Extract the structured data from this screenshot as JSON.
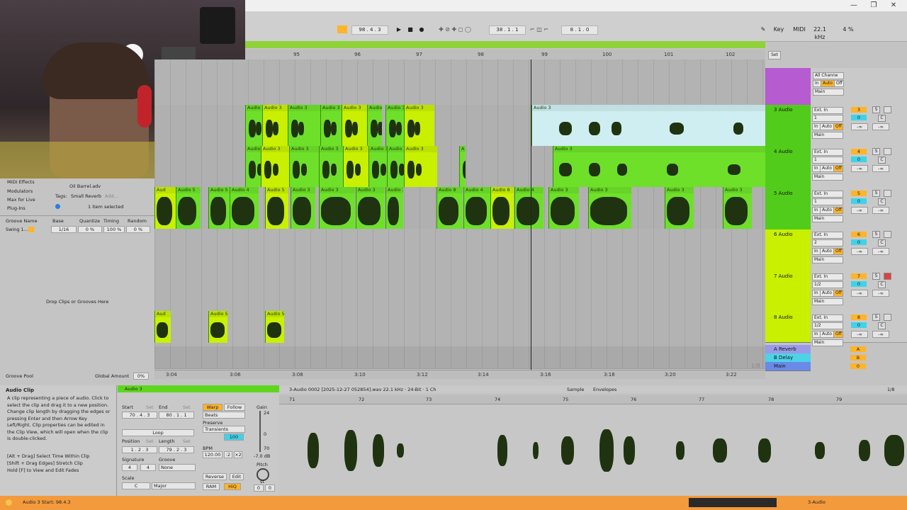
{
  "window": {
    "minimize": "—",
    "restore": "❐",
    "close": "✕"
  },
  "transport": {
    "position": "98 .  4 .  3",
    "loop_start": "38 .  1 .  1",
    "loop_length": "8 .  1 .  0",
    "key_label": "Key",
    "midi_label": "MIDI",
    "sample_rate": "22.1 kHz",
    "cpu": "4 %"
  },
  "ruler": {
    "bars": [
      "95",
      "96",
      "97",
      "98",
      "99",
      "100",
      "101",
      "102"
    ],
    "set_label": "Set"
  },
  "tracks": [
    {
      "name": "3 Audio",
      "number": "3",
      "input": "Ext. In",
      "channel": "1",
      "color": "#52cc1a"
    },
    {
      "name": "4 Audio",
      "number": "4",
      "input": "Ext. In",
      "channel": "1",
      "color": "#52cc1a"
    },
    {
      "name": "5 Audio",
      "number": "5",
      "input": "Ext. In",
      "channel": "1",
      "color": "#52cc1a"
    },
    {
      "name": "6 Audio",
      "number": "6",
      "input": "Ext. In",
      "channel": "2",
      "color": "#c8f000"
    },
    {
      "name": "7 Audio",
      "number": "7",
      "input": "Ext. In",
      "channel": "1/2",
      "color": "#c8f000"
    },
    {
      "name": "8 Audio",
      "number": "8",
      "input": "Ext. In",
      "channel": "1/2",
      "color": "#c8f000"
    }
  ],
  "top_track": {
    "input": "All Channe",
    "monitor": [
      "In",
      "Auto",
      "Off"
    ],
    "out": "Main"
  },
  "returns": [
    {
      "name": "A Reverb",
      "letter": "A"
    },
    {
      "name": "B Delay",
      "letter": "B"
    },
    {
      "name": "Main",
      "letter": "0"
    }
  ],
  "io_common": {
    "in": "In",
    "auto": "Auto",
    "off": "Off",
    "main": "Main",
    "inf": "-∞",
    "c": "C",
    "s": "S",
    "val0": "0",
    "half": "1/2"
  },
  "clip_labels": {
    "audio3": "Audio 3",
    "audio5": "Audio 5",
    "audio4": "Audio 4",
    "audio8": "Audio 8",
    "audio": "Aud",
    "a": "A"
  },
  "time_ruler": [
    "3:04",
    "3:06",
    "3:08",
    "3:10",
    "3:12",
    "3:14",
    "3:16",
    "3:18",
    "3:20",
    "3:22"
  ],
  "zoom_label": "1/8",
  "browser": {
    "items": [
      "MIDI Effects",
      "Modulators",
      "Max for Live",
      "Plug-Ins"
    ],
    "file": "Oil Barrel.adv",
    "tags_label": "Tags:",
    "tag": "Small Reverb",
    "add": "Add...",
    "selected": "1 item selected",
    "groove_headers": [
      "Groove Name",
      "Base",
      "Quantize",
      "Timing",
      "Random"
    ],
    "groove_row": {
      "name": "Swing 1...",
      "base": "1/16",
      "quantize": "0 %",
      "timing": "100 %",
      "random": "0 %"
    },
    "drop_hint": "Drop Clips or Grooves Here",
    "groove_pool": "Groove Pool",
    "global_amount_label": "Global Amount",
    "global_amount": "0%"
  },
  "info": {
    "title": "Audio Clip",
    "body": "A clip representing a piece of audio. Click to select the clip and drag it to a new position. Change clip length by dragging the edges or pressing Enter and then Arrow Key Left/Right. Clip properties can be edited in the Clip View, which will open when the clip is double-clicked.",
    "hints": [
      "[Alt + Drag] Select Time Within Clip",
      "[Shift + Drag Edges] Stretch Clip",
      "Hold [F] to View and Edit Fades"
    ]
  },
  "clip_view": {
    "clip_name": "Audio 3",
    "start_label": "Start",
    "end_label": "End",
    "set": "Set",
    "start": "70 .  4 .  3",
    "end": "80 .  1 .  1",
    "loop": "Loop",
    "position_label": "Position",
    "length_label": "Length",
    "position": "1 .  2 .  3",
    "length": "79 .  2 .  3",
    "signature_label": "Signature",
    "groove_label": "Groove",
    "sig_num": "4",
    "sig_den": "4",
    "groove": "None",
    "scale_label": "Scale",
    "scale_root": "C",
    "scale_mode": "Major",
    "warp": "Warp",
    "follow": "Follow",
    "warp_mode": "Beats",
    "preserve_label": "Preserve",
    "preserve": "Transients",
    "preserve_val": "100",
    "bpm_label": "BPM",
    "bpm": "120.00",
    "half": ":2",
    "double": "×2",
    "reverse": "Reverse",
    "edit": "Edit",
    "ram": "RAM",
    "hiq": "HiQ",
    "gain_label": "Gain",
    "gain_db": "-7.0 dB",
    "gain_ticks": [
      "24",
      "0",
      "70"
    ],
    "pitch_label": "Pitch",
    "pitch_unit": "st",
    "pitch_vals": [
      "0",
      "0"
    ]
  },
  "sample_view": {
    "file": "3-Audio 0002 [2025-12-27 052854].wav  22.1 kHz · 24-Bit · 1 Ch",
    "tab_sample": "Sample",
    "tab_envelopes": "Envelopes",
    "zoom": "1/8",
    "bars": [
      "71",
      "72",
      "73",
      "74",
      "75",
      "76",
      "77",
      "78",
      "79"
    ]
  },
  "status": {
    "text": "Audio 3  Start: 98.4.3",
    "track": "3-Audio"
  },
  "colors": {
    "status_bg": "#f39a3c",
    "clip_green": "#6ee02a",
    "clip_yellow": "#c8f000",
    "accent_orange": "#ffb429",
    "accent_cyan": "#3fd3e8",
    "purple_track": "#b75bd1"
  }
}
